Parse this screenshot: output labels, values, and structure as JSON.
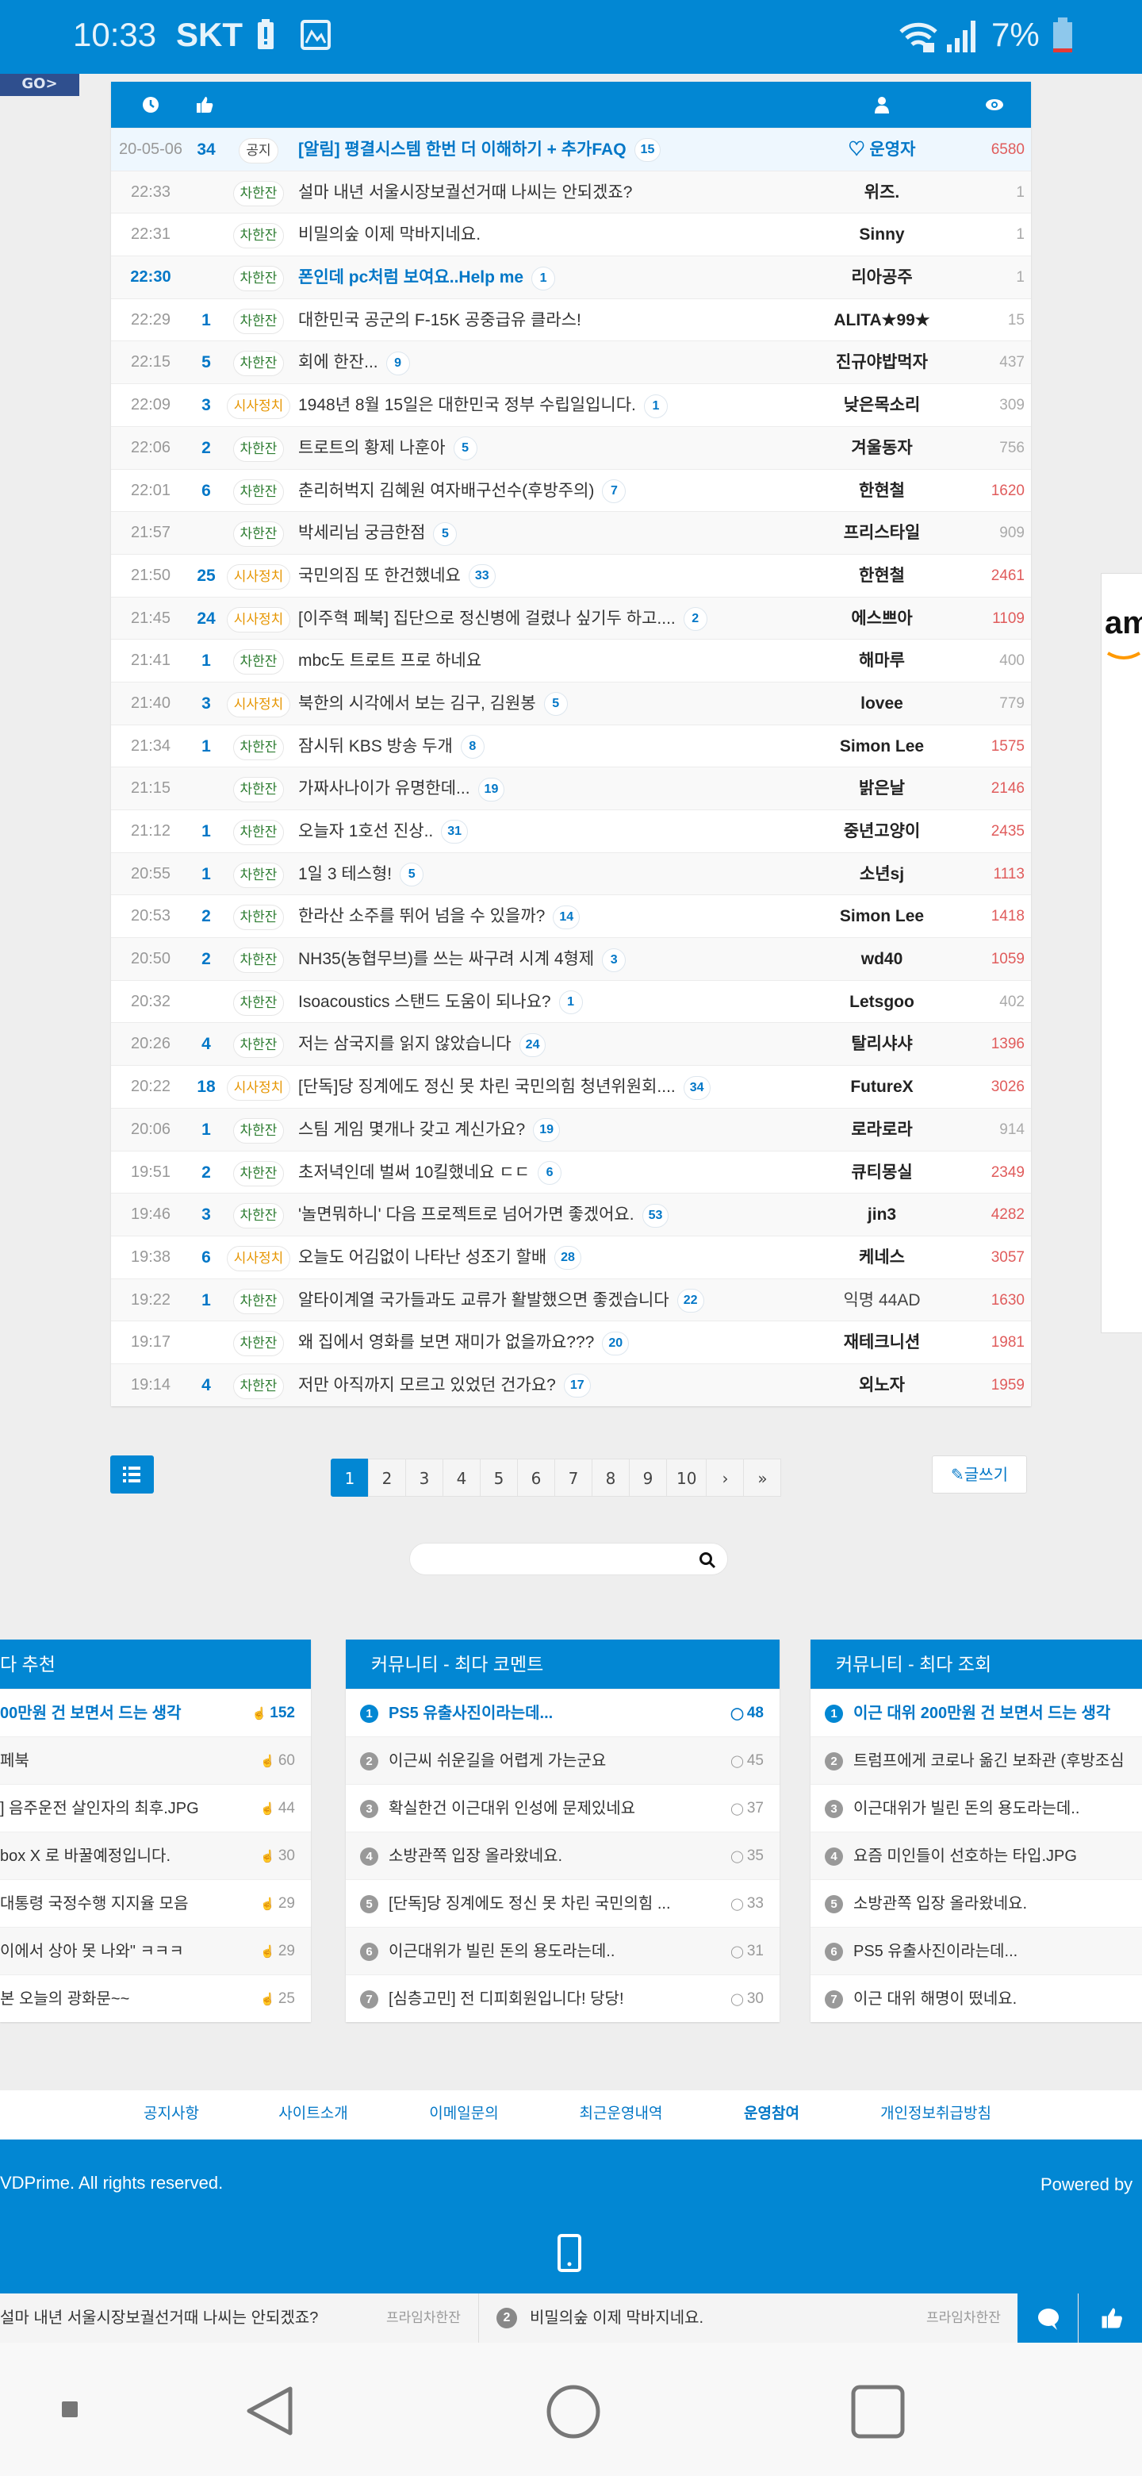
{
  "status_bar": {
    "time": "10:33",
    "carrier": "SKT",
    "battery": "7%"
  },
  "go_button": "GO>",
  "colors": {
    "primary": "#0287d3",
    "views_high": "#e05c5c",
    "category_chat": "#2e7d32",
    "category_politics": "#e69500"
  },
  "board": {
    "header_icons": [
      "clock-icon",
      "thumbs-up-icon",
      "user-icon",
      "eye-icon"
    ],
    "rows": [
      {
        "time": "20-05-06",
        "likes": "34",
        "category": "공지",
        "title": "[알림] 평결시스템 한번 더 이해하기 + 추가FAQ",
        "comments": "15",
        "author": "♡ 운영자",
        "views": "6580",
        "notice": true
      },
      {
        "time": "22:33",
        "likes": "",
        "category": "차한잔",
        "title": "설마 내년 서울시장보궐선거때 나씨는 안되겠죠?",
        "comments": "",
        "author": "위즈.",
        "views": "1"
      },
      {
        "time": "22:31",
        "likes": "",
        "category": "차한잔",
        "title": "비밀의숲 이제 막바지네요.",
        "comments": "",
        "author": "Sinny",
        "views": "1"
      },
      {
        "time": "22:30",
        "likes": "",
        "category": "차한잔",
        "title": "폰인데 pc처럼 보여요..Help me",
        "comments": "1",
        "author": "리아공주",
        "views": "1",
        "highlight": true
      },
      {
        "time": "22:29",
        "likes": "1",
        "category": "차한잔",
        "title": "대한민국 공군의 F-15K 공중급유 클라스!",
        "comments": "",
        "author": "ALITA★99★",
        "views": "15"
      },
      {
        "time": "22:15",
        "likes": "5",
        "category": "차한잔",
        "title": "회에 한잔...",
        "comments": "9",
        "author": "진규야밥먹자",
        "views": "437"
      },
      {
        "time": "22:09",
        "likes": "3",
        "category": "시사정치",
        "title": "1948년 8월 15일은 대한민국 정부 수립일입니다.",
        "comments": "1",
        "author": "낮은목소리",
        "views": "309"
      },
      {
        "time": "22:06",
        "likes": "2",
        "category": "차한잔",
        "title": "트로트의 황제 나훈아",
        "comments": "5",
        "author": "겨울동자",
        "views": "756"
      },
      {
        "time": "22:01",
        "likes": "6",
        "category": "차한잔",
        "title": "춘리허벅지 김혜원 여자배구선수(후방주의)",
        "comments": "7",
        "author": "한현철",
        "views": "1620"
      },
      {
        "time": "21:57",
        "likes": "",
        "category": "차한잔",
        "title": "박세리님 궁금한점",
        "comments": "5",
        "author": "프리스타일",
        "views": "909"
      },
      {
        "time": "21:50",
        "likes": "25",
        "category": "시사정치",
        "title": "국민의짐 또 한건했네요",
        "comments": "33",
        "author": "한현철",
        "views": "2461"
      },
      {
        "time": "21:45",
        "likes": "24",
        "category": "시사정치",
        "title": "[이주혁 페북] 집단으로 정신병에 걸렸나 싶기두 하고....",
        "comments": "2",
        "author": "에스쁘아",
        "views": "1109"
      },
      {
        "time": "21:41",
        "likes": "1",
        "category": "차한잔",
        "title": "mbc도 트로트 프로 하네요",
        "comments": "",
        "author": "해마루",
        "views": "400"
      },
      {
        "time": "21:40",
        "likes": "3",
        "category": "시사정치",
        "title": "북한의 시각에서 보는 김구, 김원봉",
        "comments": "5",
        "author": "lovee",
        "views": "779"
      },
      {
        "time": "21:34",
        "likes": "1",
        "category": "차한잔",
        "title": "잠시뒤 KBS 방송 두개",
        "comments": "8",
        "author": "Simon Lee",
        "views": "1575"
      },
      {
        "time": "21:15",
        "likes": "",
        "category": "차한잔",
        "title": "가짜사나이가 유명한데...",
        "comments": "19",
        "author": "밝은날",
        "views": "2146"
      },
      {
        "time": "21:12",
        "likes": "1",
        "category": "차한잔",
        "title": "오늘자 1호선 진상..",
        "comments": "31",
        "author": "중년고양이",
        "views": "2435"
      },
      {
        "time": "20:55",
        "likes": "1",
        "category": "차한잔",
        "title": "1일 3 테스형!",
        "comments": "5",
        "author": "소년sj",
        "views": "1113"
      },
      {
        "time": "20:53",
        "likes": "2",
        "category": "차한잔",
        "title": "한라산 소주를 뛰어 넘을 수 있을까?",
        "comments": "14",
        "author": "Simon Lee",
        "views": "1418"
      },
      {
        "time": "20:50",
        "likes": "2",
        "category": "차한잔",
        "title": "NH35(농협무브)를 쓰는 싸구려 시계 4형제",
        "comments": "3",
        "author": "wd40",
        "views": "1059"
      },
      {
        "time": "20:32",
        "likes": "",
        "category": "차한잔",
        "title": "Isoacoustics 스탠드 도움이 되나요?",
        "comments": "1",
        "author": "Letsgoo",
        "views": "402"
      },
      {
        "time": "20:26",
        "likes": "4",
        "category": "차한잔",
        "title": "저는 삼국지를 읽지 않았습니다",
        "comments": "24",
        "author": "탈리샤샤",
        "views": "1396"
      },
      {
        "time": "20:22",
        "likes": "18",
        "category": "시사정치",
        "title": "[단독]당 징계에도 정신 못 차린 국민의힘 청년위원회....",
        "comments": "34",
        "author": "FutureX",
        "views": "3026"
      },
      {
        "time": "20:06",
        "likes": "1",
        "category": "차한잔",
        "title": "스팀 게임 몇개나 갖고 계신가요?",
        "comments": "19",
        "author": "로라로라",
        "views": "914"
      },
      {
        "time": "19:51",
        "likes": "2",
        "category": "차한잔",
        "title": "초저녁인데 벌써 10킬했네요 ㄷㄷ",
        "comments": "6",
        "author": "큐티몽실",
        "views": "2349"
      },
      {
        "time": "19:46",
        "likes": "3",
        "category": "차한잔",
        "title": "'놀면뭐하니' 다음 프로젝트로 넘어가면 좋겠어요.",
        "comments": "53",
        "author": "jin3",
        "views": "4282"
      },
      {
        "time": "19:38",
        "likes": "6",
        "category": "시사정치",
        "title": "오늘도 어김없이 나타난 성조기 할배",
        "comments": "28",
        "author": "케네스",
        "views": "3057"
      },
      {
        "time": "19:22",
        "likes": "1",
        "category": "차한잔",
        "title": "알타이계열 국가들과도 교류가 활발했으면 좋겠습니다",
        "comments": "22",
        "author": "익명 44AD",
        "views": "1630",
        "anon": true
      },
      {
        "time": "19:17",
        "likes": "",
        "category": "차한잔",
        "title": "왜 집에서 영화를 보면 재미가 없을까요???",
        "comments": "20",
        "author": "재테크니션",
        "views": "1981"
      },
      {
        "time": "19:14",
        "likes": "4",
        "category": "차한잔",
        "title": "저만 아직까지 모르고 있었던 건가요?",
        "comments": "17",
        "author": "외노자",
        "views": "1959"
      }
    ]
  },
  "pagination": {
    "pages": [
      "1",
      "2",
      "3",
      "4",
      "5",
      "6",
      "7",
      "8",
      "9",
      "10"
    ],
    "current": "1",
    "next": "›",
    "last": "»"
  },
  "write_button": "글쓰기",
  "search": {
    "placeholder": "",
    "value": ""
  },
  "ad": {
    "logo_text": "am"
  },
  "cards": [
    {
      "title": "다 추천",
      "count_icon": "thumbs-up-icon",
      "items": [
        {
          "title": "00만원 건 보면서 드는 생각",
          "count": "152"
        },
        {
          "title": " 페북",
          "count": "60"
        },
        {
          "title": "] 음주운전 살인자의 최후.JPG",
          "count": "44"
        },
        {
          "title": "box X 로 바꿀예정입니다.",
          "count": "30"
        },
        {
          "title": "대통령 국정수행 지지율 모음",
          "count": "29"
        },
        {
          "title": "이에서 상아 못 나와\" ㅋㅋㅋ",
          "count": "29"
        },
        {
          "title": " 본 오늘의 광화문~~",
          "count": "25"
        }
      ]
    },
    {
      "title": "커뮤니티 - 최다 코멘트",
      "count_icon": "comment-icon",
      "items": [
        {
          "title": "PS5 유출사진이라는데...",
          "count": "48"
        },
        {
          "title": "이근씨 쉬운길을 어렵게 가는군요",
          "count": "45"
        },
        {
          "title": "확실한건 이근대위 인성에 문제있네요",
          "count": "37"
        },
        {
          "title": "소방관쪽 입장 올라왔네요.",
          "count": "35"
        },
        {
          "title": "[단독]당 징계에도 정신 못 차린 국민의힘 ...",
          "count": "33"
        },
        {
          "title": "이근대위가 빌린 돈의 용도라는데..",
          "count": "31"
        },
        {
          "title": "[심층고민] 전 디피회원입니다! 당당!",
          "count": "30"
        }
      ]
    },
    {
      "title": "커뮤니티 - 최다 조회",
      "count_icon": "",
      "items": [
        {
          "title": "이근 대위 200만원 건 보면서 드는 생각",
          "count": ""
        },
        {
          "title": "트럼프에게 코로나 옮긴 보좌관 (후방조심",
          "count": ""
        },
        {
          "title": "이근대위가 빌린 돈의 용도라는데..",
          "count": ""
        },
        {
          "title": "요즘 미인들이 선호하는 타입.JPG",
          "count": ""
        },
        {
          "title": "소방관쪽 입장 올라왔네요.",
          "count": ""
        },
        {
          "title": "PS5 유출사진이라는데...",
          "count": ""
        },
        {
          "title": "이근 대위 해명이 떴네요.",
          "count": ""
        }
      ]
    }
  ],
  "footer": {
    "links": [
      "공지사항",
      "사이트소개",
      "이메일문의",
      "최근운영내역",
      "운영참여",
      "개인정보취급방침"
    ],
    "copyright": "VDPrime. All rights reserved.",
    "powered": "Powered by"
  },
  "ticker": {
    "item1": "설마 내년 서울시장보궐선거때 나씨는 안되겠죠?",
    "item1_board": "프라임차한잔",
    "item2_num": "2",
    "item2": "비밀의숲 이제 막바지네요.",
    "item2_board": "프라임차한잔"
  }
}
